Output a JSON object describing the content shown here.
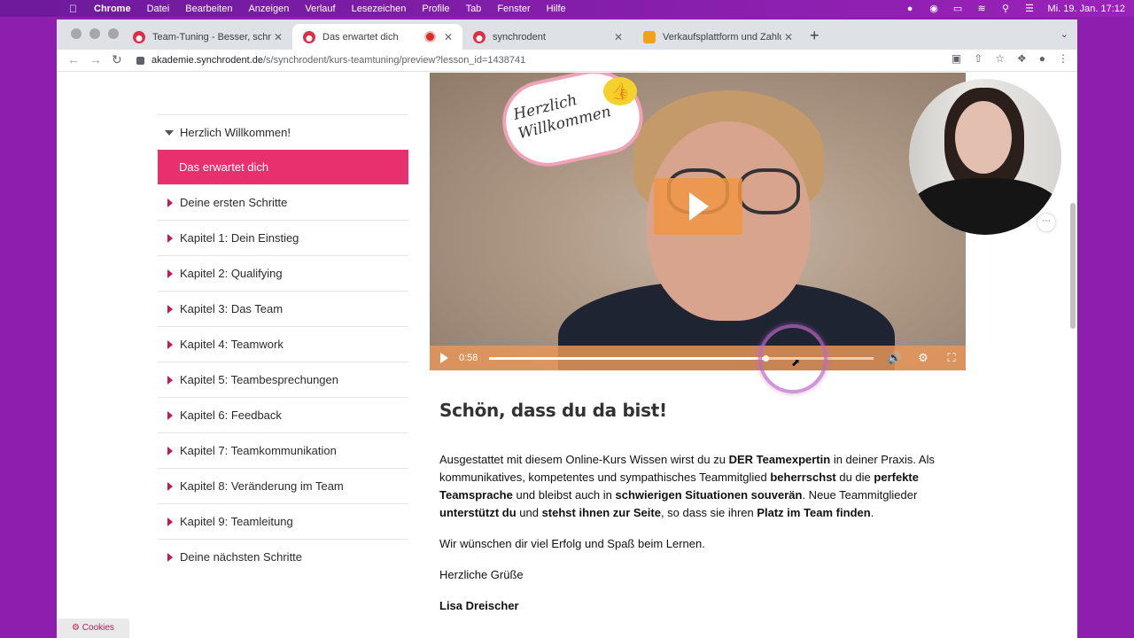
{
  "menubar": {
    "app": "Chrome",
    "items": [
      "Datei",
      "Bearbeiten",
      "Anzeigen",
      "Verlauf",
      "Lesezeichen",
      "Profile",
      "Tab",
      "Fenster",
      "Hilfe"
    ],
    "clock": "Mi. 19. Jan. 17:12"
  },
  "tabs": [
    {
      "title": "Team-Tuning - Besser, schnelle",
      "favicon": "synchrodent-icon"
    },
    {
      "title": "Das erwartet dich",
      "favicon": "synchrodent-icon",
      "recording": true
    },
    {
      "title": "synchrodent",
      "favicon": "synchrodent-icon"
    },
    {
      "title": "Verkaufsplattform und Zahlung",
      "favicon": "shop-icon"
    }
  ],
  "toolbar": {
    "url_host": "akademie.synchrodent.de",
    "url_path": "/s/synchrodent/kurs-teamtuning/preview?lesson_id=1438741"
  },
  "sidebar": {
    "section": "Herzlich Willkommen!",
    "active": "Das erwartet dich",
    "items": [
      "Deine ersten Schritte",
      "Kapitel 1: Dein Einstieg",
      "Kapitel 2: Qualifying",
      "Kapitel 3: Das Team",
      "Kapitel 4: Teamwork",
      "Kapitel 5: Teambesprechungen",
      "Kapitel 6: Feedback",
      "Kapitel 7: Teamkommunikation",
      "Kapitel 8: Veränderung im Team",
      "Kapitel 9: Teamleitung",
      "Deine nächsten Schritte"
    ]
  },
  "video": {
    "sign_line1": "Herzlich",
    "sign_line2": "Willkommen",
    "time": "0:58",
    "progress": 0.72
  },
  "article": {
    "heading": "Schön, dass du da bist!",
    "p1_a": "Ausgestattet mit diesem Online-Kurs Wissen wirst du zu ",
    "p1_b": "DER Teamexpertin",
    "p1_c": " in deiner Praxis. Als kommunikatives, kompetentes und sympathisches Teammitglied ",
    "p1_d": "beherrschst",
    "p1_e": " du die ",
    "p1_f": "perfekte Teamsprache",
    "p1_g": " und bleibst auch in ",
    "p1_h": "schwierigen Situationen souverän",
    "p1_i": ". Neue Teammitglieder ",
    "p1_j": "unterstützt du",
    "p1_k": " und ",
    "p1_l": "stehst ihnen zur Seite",
    "p1_m": ", so dass sie ihren ",
    "p1_n": "Platz im Team finden",
    "p1_o": ".",
    "p2": "Wir wünschen dir viel Erfolg und Spaß beim Lernen.",
    "p3": "Herzliche Grüße",
    "signature": "Lisa Dreischer"
  },
  "cookies_label": "Cookies"
}
